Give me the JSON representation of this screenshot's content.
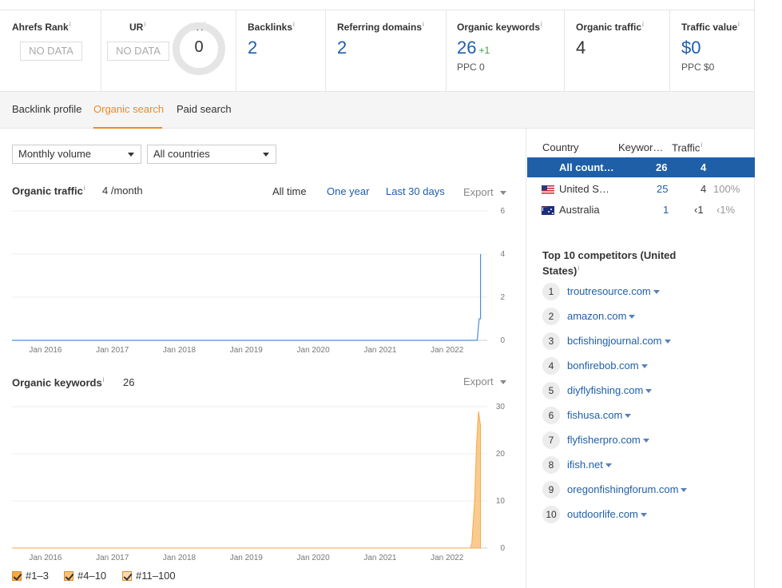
{
  "metrics": {
    "ahrefs_rank": {
      "label": "Ahrefs Rank",
      "value": "NO DATA"
    },
    "ur": {
      "label": "UR",
      "value": "NO DATA"
    },
    "dr": {
      "label": "DR",
      "value": "0"
    },
    "backlinks": {
      "label": "Backlinks",
      "value": "2"
    },
    "referring_domains": {
      "label": "Referring domains",
      "value": "2"
    },
    "organic_keywords": {
      "label": "Organic keywords",
      "value": "26",
      "delta": "+1",
      "sub": "PPC 0"
    },
    "organic_traffic": {
      "label": "Organic traffic",
      "value": "4"
    },
    "traffic_value": {
      "label": "Traffic value",
      "value": "$0",
      "sub": "PPC $0"
    },
    "info_mark": "i"
  },
  "tabs": [
    {
      "label": "Backlink profile"
    },
    {
      "label": "Organic search",
      "active": true
    },
    {
      "label": "Paid search"
    }
  ],
  "filters": {
    "volume": "Monthly volume",
    "country": "All countries"
  },
  "organic_traffic": {
    "title": "Organic traffic",
    "value": "4 /month",
    "ranges": [
      "All time",
      "One year",
      "Last 30 days"
    ],
    "export": "Export"
  },
  "organic_keywords": {
    "title": "Organic keywords",
    "value": "26",
    "export": "Export"
  },
  "legend": [
    "#1–3",
    "#4–10",
    "#11–100"
  ],
  "chart_data": [
    {
      "type": "line",
      "title": "Organic traffic",
      "x_ticks": [
        "Jan 2016",
        "Jan 2017",
        "Jan 2018",
        "Jan 2019",
        "Jan 2020",
        "Jan 2021",
        "Jan 2022"
      ],
      "y_ticks": [
        0,
        2,
        4,
        6
      ],
      "ylim": [
        0,
        6
      ],
      "x_range": [
        2015.5,
        2022.6
      ],
      "series": [
        {
          "x": [
            2015.5,
            2022.4,
            2022.45,
            2022.48,
            2022.5,
            2022.5
          ],
          "values": [
            0,
            0,
            0,
            1,
            1,
            4
          ],
          "color": "#4a90d9"
        }
      ]
    },
    {
      "type": "area",
      "title": "Organic keywords",
      "x_ticks": [
        "Jan 2016",
        "Jan 2017",
        "Jan 2018",
        "Jan 2019",
        "Jan 2020",
        "Jan 2021",
        "Jan 2022"
      ],
      "y_ticks": [
        0,
        10,
        20,
        30
      ],
      "ylim": [
        0,
        30
      ],
      "x_range": [
        2015.5,
        2022.6
      ],
      "series": [
        {
          "name": "#11–100",
          "x": [
            2015.5,
            2022.35,
            2022.37,
            2022.41,
            2022.44,
            2022.46,
            2022.47,
            2022.5
          ],
          "values": [
            0,
            0,
            1,
            10,
            22,
            27,
            29,
            26
          ],
          "color": "#f8c27a"
        }
      ]
    }
  ],
  "countries": {
    "headers": [
      "Country",
      "Keywor…",
      "Traffic"
    ],
    "rows": [
      {
        "name": "All count…",
        "keywords": "26",
        "traffic": "4",
        "share": "",
        "selected": true
      },
      {
        "name": "United S…",
        "keywords": "25",
        "traffic": "4",
        "share": "100%",
        "flag": "us"
      },
      {
        "name": "Australia",
        "keywords": "1",
        "traffic": "‹1",
        "share": "‹1%",
        "flag": "au"
      }
    ]
  },
  "competitors": {
    "title": "Top 10 competitors (United States)",
    "items": [
      "troutresource.com",
      "amazon.com",
      "bcfishingjournal.com",
      "bonfirebob.com",
      "diyflyfishing.com",
      "fishusa.com",
      "flyfisherpro.com",
      "ifish.net",
      "oregonfishingforum.com",
      "outdoorlife.com"
    ]
  },
  "colors": {
    "accent": "#f08a24",
    "link": "#1f5fa8",
    "selected_row": "#1f5fa8"
  }
}
